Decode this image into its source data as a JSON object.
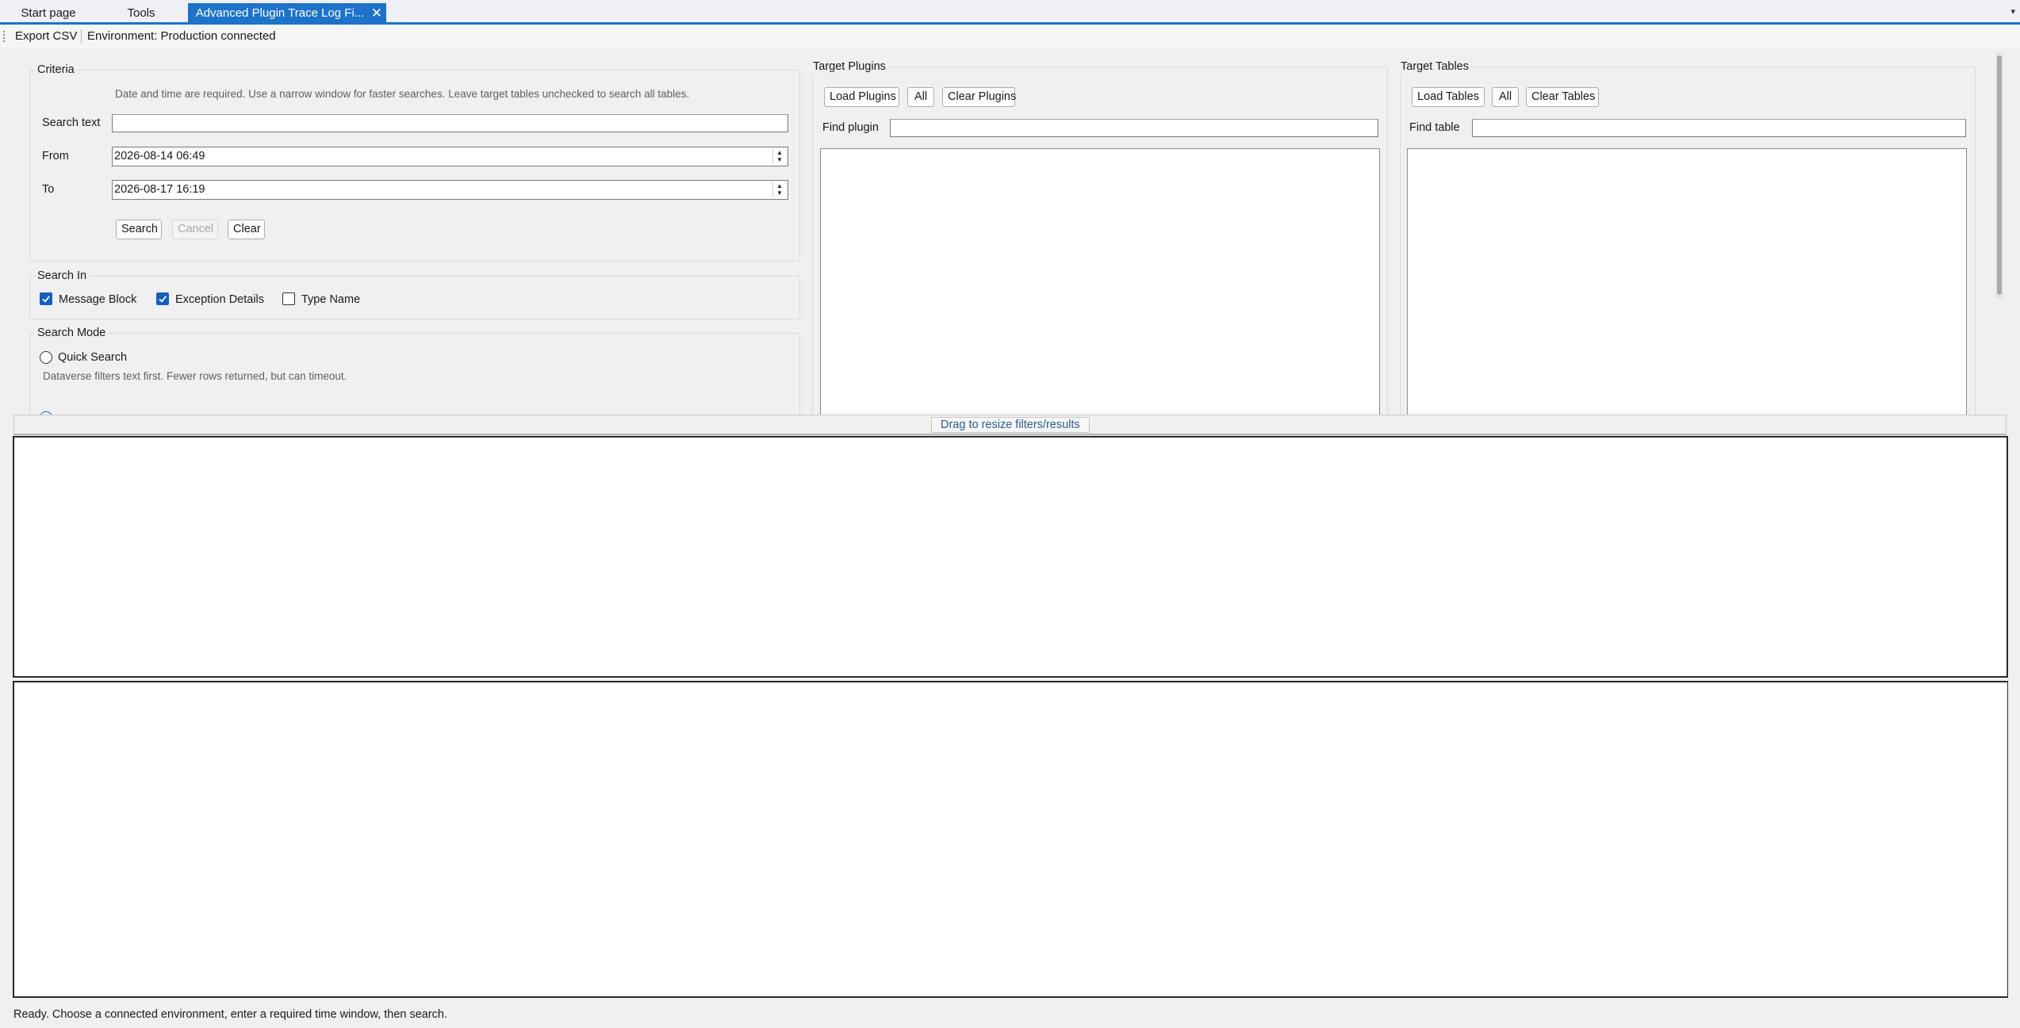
{
  "tabs": {
    "start_page": "Start page",
    "tools": "Tools",
    "active": "Advanced Plugin Trace Log Fi...",
    "close_glyph": "✕",
    "overflow_glyph": "▾"
  },
  "toolbar": {
    "export_csv": "Export CSV",
    "environment": "Environment: Production connected"
  },
  "criteria": {
    "title": "Criteria",
    "hint": "Date and time are required. Use a narrow window for faster searches. Leave target tables unchecked to search all tables.",
    "search_text_label": "Search text",
    "search_text_value": "",
    "from_label": "From",
    "from_value": "2026-08-14 06:49",
    "to_label": "To",
    "to_value": "2026-08-17 16:19",
    "search_button": "Search",
    "cancel_button": "Cancel",
    "clear_button": "Clear"
  },
  "search_in": {
    "title": "Search In",
    "options": [
      {
        "label": "Message Block",
        "checked": true
      },
      {
        "label": "Exception Details",
        "checked": true
      },
      {
        "label": "Type Name",
        "checked": false
      }
    ]
  },
  "search_mode": {
    "title": "Search Mode",
    "quick_search_label": "Quick Search",
    "quick_search_hint": "Dataverse filters text first. Fewer rows returned, but can timeout.",
    "quick_search_selected": false
  },
  "target_plugins": {
    "title": "Target Plugins",
    "load_button": "Load Plugins",
    "all_button": "All",
    "clear_button": "Clear Plugins",
    "find_label": "Find plugin",
    "find_value": ""
  },
  "target_tables": {
    "title": "Target Tables",
    "load_button": "Load Tables",
    "all_button": "All",
    "clear_button": "Clear Tables",
    "find_label": "Find table",
    "find_value": ""
  },
  "splitter": {
    "label": "Drag to resize filters/results"
  },
  "status": {
    "text": "Ready. Choose a connected environment, enter a required time window, then search."
  },
  "colors": {
    "accent": "#1c73c9",
    "checkbox": "#1560bd",
    "splitter_text": "#2a5d8f"
  }
}
